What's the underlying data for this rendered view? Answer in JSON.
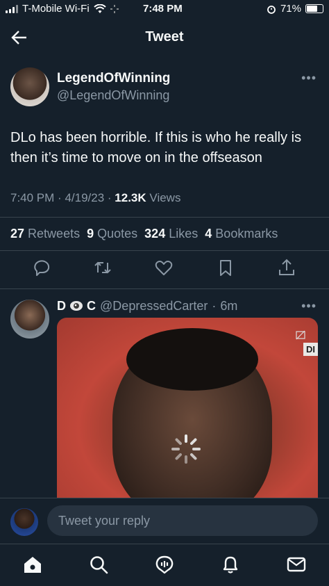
{
  "status_bar": {
    "carrier": "T-Mobile Wi-Fi",
    "time": "7:48 PM",
    "battery": "71%"
  },
  "header": {
    "title": "Tweet"
  },
  "tweet": {
    "display_name": "LegendOfWinning",
    "handle": "@LegendOfWinning",
    "text": "DLo has been horrible. If this is who he really is then it’s time to move on in the offseason",
    "time": "7:40 PM",
    "date": "4/19/23",
    "views_count": "12.3K",
    "views_label": "Views",
    "stats": [
      {
        "count": "27",
        "label": "Retweets"
      },
      {
        "count": "9",
        "label": "Quotes"
      },
      {
        "count": "324",
        "label": "Likes"
      },
      {
        "count": "4",
        "label": "Bookmarks"
      }
    ],
    "actions": [
      "reply-icon",
      "retweet-icon",
      "like-icon",
      "bookmark-icon",
      "share-icon"
    ]
  },
  "reply": {
    "display_name_prefix": "D",
    "display_name_suffix": "C",
    "handle": "@DepressedCarter",
    "age": "6m",
    "media_tag": "DI"
  },
  "reply_bar": {
    "placeholder": "Tweet your reply"
  },
  "tab_bar": {
    "items": [
      "home-icon",
      "search-icon",
      "spaces-icon",
      "notifications-icon",
      "messages-icon"
    ]
  },
  "colors": {
    "background": "#15202b",
    "text": "#f7f9f9",
    "muted": "#8b98a5",
    "divider": "#38444d"
  }
}
